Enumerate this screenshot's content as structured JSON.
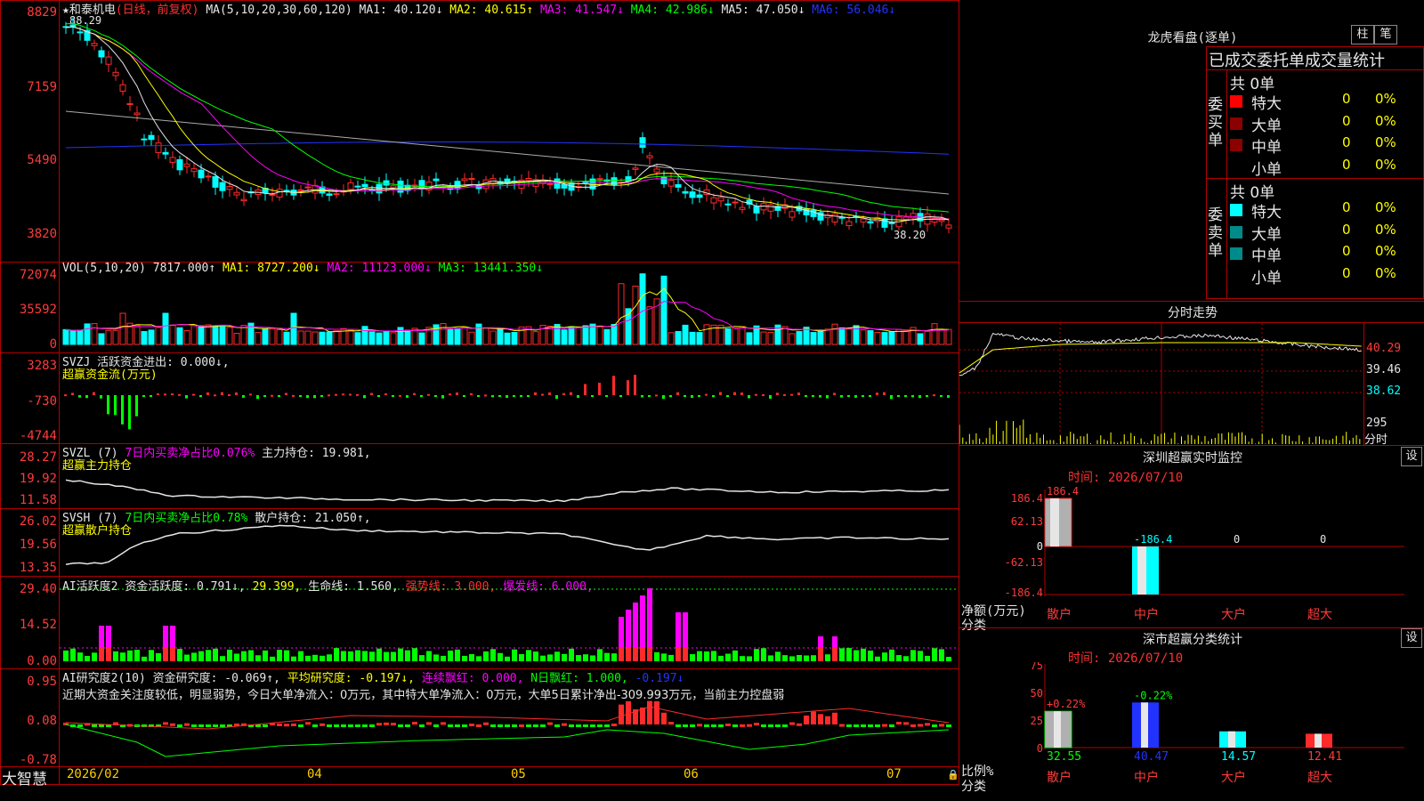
{
  "main": {
    "stock_name": "★和泰机电",
    "mode": "(日线，前复权)",
    "ma_label": "MA(5,10,20,30,60,120)",
    "ma1": "MA1: 40.120↓",
    "ma2": "MA2: 40.615↑",
    "ma3": "MA3: 41.547↓",
    "ma4": "MA4: 42.986↓",
    "ma5": "MA5: 47.050↓",
    "ma6": "MA6: 56.046↓",
    "high_label": "88.29",
    "low_label": "38.20",
    "y_ticks": [
      "8829",
      "7159",
      "5490",
      "3820"
    ]
  },
  "volume": {
    "label": "VOL(5,10,20)",
    "value": "7817.000↑",
    "ma1": "MA1: 8727.200↓",
    "ma2": "MA2: 11123.000↓",
    "ma3": "MA3: 13441.350↓",
    "y_ticks": [
      "72074",
      "35592",
      "0"
    ]
  },
  "svzj": {
    "label": "SVZJ",
    "text": "活跃资金进出: 0.000↓,",
    "subtitle": "超赢资金流(万元)",
    "y_ticks": [
      "3283",
      "-730",
      "-4744"
    ]
  },
  "svzl": {
    "label": "SVZL (7)",
    "ratio": "7日内买卖净占比0.076%",
    "hold": "主力持仓: 19.981,",
    "subtitle": "超赢主力持仓",
    "y_ticks": [
      "28.27",
      "19.92",
      "11.58"
    ]
  },
  "svsh": {
    "label": "SVSH (7)",
    "ratio": "7日内买卖净占比0.78%",
    "hold": "散户持仓: 21.050↑,",
    "subtitle": "超赢散户持仓",
    "y_ticks": [
      "26.02",
      "19.56",
      "13.35"
    ]
  },
  "ai_active": {
    "label": "AI活跃度2",
    "a": "资金活跃度: 0.791↓,",
    "b": "29.399,",
    "c": "生命线: 1.560,",
    "d": "强势线: 3.000,",
    "e": "爆发线: 6.000,",
    "y_ticks": [
      "29.40",
      "14.52",
      "0.00"
    ]
  },
  "ai_research": {
    "label": "AI研究度2(10)",
    "a": "资金研究度: -0.069↑,",
    "b": "平均研究度: -0.197↓,",
    "c": "连续飘红: 0.000,",
    "d": "N日飘红: 1.000,",
    "e": "-0.197↓",
    "comment": "近期大资金关注度较低，明显弱势，今日大单净流入：0万元，其中特大单净流入：0万元，大单5日累计净出-309.993万元，当前主力控盘弱",
    "y_ticks": [
      "0.95",
      "0.08",
      "-0.78"
    ]
  },
  "x_axis": {
    "brand": "大智慧",
    "labels": [
      "2026/02",
      "04",
      "05",
      "06",
      "07"
    ]
  },
  "dragon_tiger": {
    "title": "龙虎看盘(逐单)",
    "btn_bar": "柱",
    "btn_pen": "笔",
    "header": "已成交委托单成交量统计",
    "buy_label": "委买单",
    "sell_label": "委卖单",
    "buy_total": "共 0单",
    "sell_total": "共 0单",
    "buy_rows": [
      {
        "name": "特大",
        "count": "0",
        "pct": "0%"
      },
      {
        "name": "大单",
        "count": "0",
        "pct": "0%"
      },
      {
        "name": "中单",
        "count": "0",
        "pct": "0%"
      },
      {
        "name": "小单",
        "count": "0",
        "pct": "0%"
      }
    ],
    "sell_rows": [
      {
        "name": "特大",
        "count": "0",
        "pct": "0%"
      },
      {
        "name": "大单",
        "count": "0",
        "pct": "0%"
      },
      {
        "name": "中单",
        "count": "0",
        "pct": "0%"
      },
      {
        "name": "小单",
        "count": "0",
        "pct": "0%"
      }
    ]
  },
  "intraday": {
    "title": "分时走势",
    "price_ticks": [
      "40.29",
      "39.46",
      "38.62"
    ],
    "vol_tick": "295",
    "vol_unit": "分时"
  },
  "sz_monitor": {
    "title": "深圳超赢实时监控",
    "settings": "设",
    "time": "时间: 2026/07/10",
    "y_ticks": [
      "186.4",
      "62.13",
      "0",
      "-62.13",
      "-186.4"
    ],
    "axis_title": "净额(万元)",
    "axis_sub": "分类",
    "categories": [
      "散户",
      "中户",
      "大户",
      "超大"
    ],
    "values": [
      "186.4",
      "-186.4",
      "0",
      "0"
    ]
  },
  "sz_class": {
    "title": "深市超赢分类统计",
    "settings": "设",
    "time": "时间: 2026/07/10",
    "y_ticks": [
      "75",
      "50",
      "25",
      "0"
    ],
    "axis_title": "比例%",
    "axis_sub": "分类",
    "categories": [
      "散户",
      "中户",
      "大户",
      "超大"
    ],
    "values": [
      "32.55",
      "40.47",
      "14.57",
      "12.41"
    ],
    "changes": [
      "+0.22%",
      "-0.22%",
      "",
      ""
    ]
  },
  "colors": {
    "grid": "#b00000",
    "up": "#ff2a2a",
    "down": "#00ffff",
    "ma1": "#e6e6e6",
    "ma2": "#ffff00",
    "ma3": "#ff00ff",
    "ma4": "#00ff00",
    "ma5": "#aaaaaa",
    "ma6": "#2233ff"
  }
}
